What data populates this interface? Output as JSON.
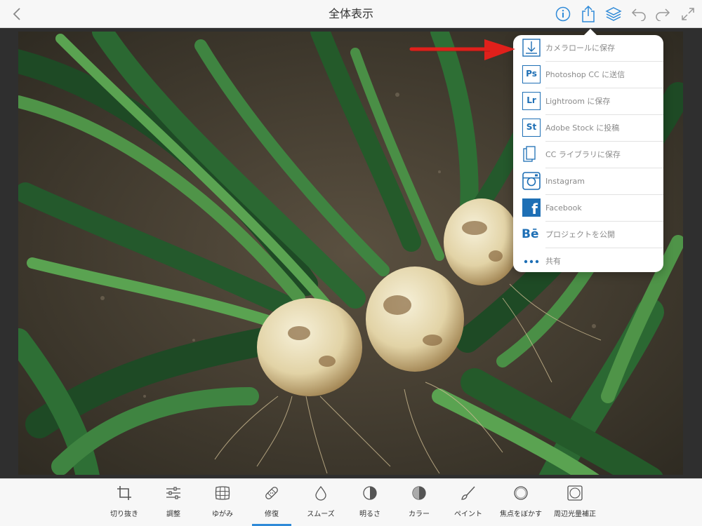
{
  "topbar": {
    "title": "全体表示",
    "icons": [
      "back-chevron-icon",
      "info-icon",
      "share-icon",
      "layers-icon",
      "undo-icon",
      "redo-icon",
      "fullscreen-icon"
    ],
    "accent": "#2f8ad8"
  },
  "share_menu": {
    "items": [
      {
        "label": "カメラロールに保存",
        "icon": "camera-roll-download-icon"
      },
      {
        "label": "Photoshop CC に送信",
        "icon": "photoshop-icon",
        "glyph": "Ps"
      },
      {
        "label": "Lightroom に保存",
        "icon": "lightroom-icon",
        "glyph": "Lr"
      },
      {
        "label": "Adobe Stock に投稿",
        "icon": "adobe-stock-icon",
        "glyph": "St"
      },
      {
        "label": "CC ライブラリに保存",
        "icon": "cc-libraries-icon"
      },
      {
        "label": "Instagram",
        "icon": "instagram-icon"
      },
      {
        "label": "Facebook",
        "icon": "facebook-icon",
        "glyph": "f"
      },
      {
        "label": "プロジェクトを公開",
        "icon": "behance-icon",
        "glyph": "Bē"
      },
      {
        "label": "共有",
        "icon": "more-dots-icon"
      }
    ],
    "icon_color": "#1e6fb5"
  },
  "tools": [
    {
      "label": "切り抜き",
      "icon": "crop-icon"
    },
    {
      "label": "調整",
      "icon": "sliders-icon"
    },
    {
      "label": "ゆがみ",
      "icon": "warp-grid-icon"
    },
    {
      "label": "修復",
      "icon": "bandage-icon",
      "active": true
    },
    {
      "label": "スムーズ",
      "icon": "drop-icon"
    },
    {
      "label": "明るさ",
      "icon": "half-circle-icon"
    },
    {
      "label": "カラー",
      "icon": "color-circle-icon"
    },
    {
      "label": "ペイント",
      "icon": "brush-icon"
    },
    {
      "label": "焦点をぼかす",
      "icon": "focus-circle-icon"
    },
    {
      "label": "周辺光量補正",
      "icon": "vignette-icon"
    }
  ],
  "annotation": {
    "arrow_color": "#e0201b"
  }
}
